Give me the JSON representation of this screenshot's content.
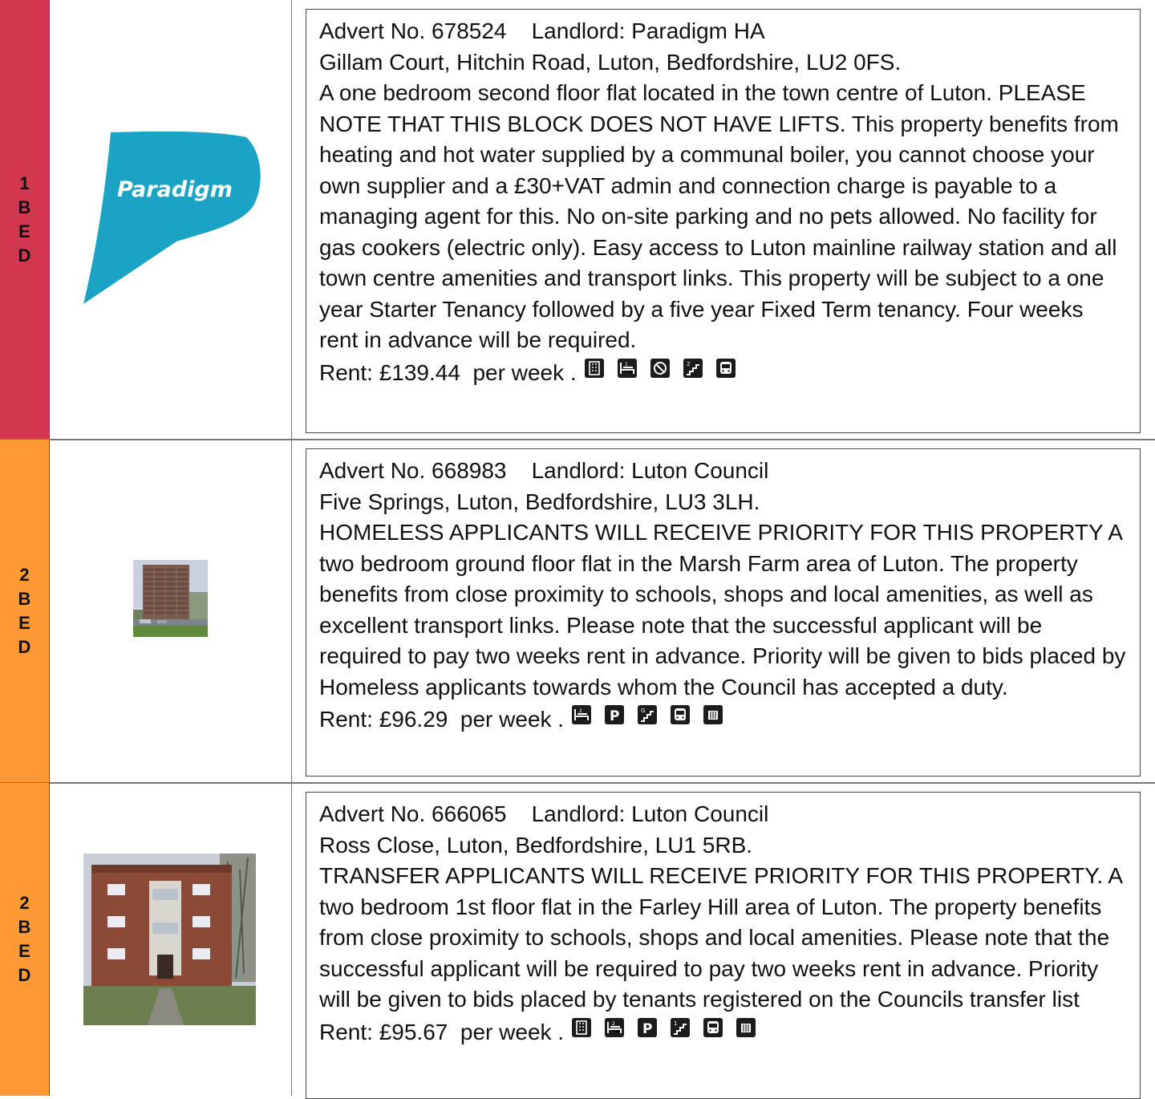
{
  "listings": [
    {
      "band": [
        "1",
        "B",
        "E",
        "D"
      ],
      "band_color": "#d1374f",
      "image_name": "paradigm-logo",
      "logo_text": "Paradigm",
      "header": "Advert No. 678524    Landlord: Paradigm HA",
      "address": "Gillam Court, Hitchin Road, Luton, Bedfordshire, LU2 0FS.",
      "description": "A one bedroom second floor flat located in the town centre of Luton. PLEASE NOTE THAT THIS BLOCK DOES NOT HAVE LIFTS. This property benefits from heating and hot water supplied by a communal boiler, you cannot choose your own supplier and a £30+VAT admin and connection charge is payable to a managing agent for this. No on-site parking and no pets allowed. No facility for gas cookers (electric only). Easy access to Luton mainline railway station and all town centre amenities and transport links. This property will be subject to a one year Starter Tenancy followed by a five year Fixed Term tenancy. Four weeks rent in advance will be required.",
      "rent": "Rent: £139.44  per week .",
      "icons": [
        "flat-block-icon",
        "bedroom-1-icon",
        "no-pets-icon",
        "floor-2-stairs-icon",
        "bus-icon"
      ]
    },
    {
      "band": [
        "2",
        "B",
        "E",
        "D"
      ],
      "band_color": "#ff9934",
      "image_name": "tower-block-photo",
      "header": "Advert No. 668983    Landlord: Luton Council",
      "address": "Five Springs, Luton, Bedfordshire, LU3 3LH.",
      "description": "HOMELESS APPLICANTS WILL RECEIVE PRIORITY FOR THIS PROPERTY A two bedroom ground floor flat in the Marsh Farm area of Luton. The property benefits from close proximity to schools, shops and local amenities, as well as excellent transport links. Please note that the successful applicant will be required to pay two weeks rent in advance. Priority will be given to bids placed by Homeless applicants towards whom the Council has accepted a duty.",
      "rent": "Rent: £96.29  per week .",
      "icons": [
        "bedroom-2-icon",
        "parking-icon",
        "ground-floor-stairs-icon",
        "bus-icon",
        "heating-icon"
      ]
    },
    {
      "band": [
        "2",
        "B",
        "E",
        "D"
      ],
      "band_color": "#ff9934",
      "image_name": "low-rise-flats-photo",
      "header": "Advert No. 666065    Landlord: Luton Council",
      "address": "Ross Close, Luton, Bedfordshire, LU1 5RB.",
      "description": "TRANSFER APPLICANTS WILL RECEIVE PRIORITY FOR THIS PROPERTY. A two bedroom 1st floor flat in the Farley Hill area of Luton. The property benefits from close proximity to schools, shops and local amenities. Please note that the successful applicant will be required to pay two weeks rent in advance. Priority will be given to bids placed by tenants registered on the Councils transfer list",
      "rent": "Rent: £95.67  per week .",
      "icons": [
        "flat-block-icon",
        "bedroom-2-icon",
        "parking-icon",
        "floor-1-stairs-icon",
        "bus-icon",
        "heating-icon"
      ]
    }
  ]
}
